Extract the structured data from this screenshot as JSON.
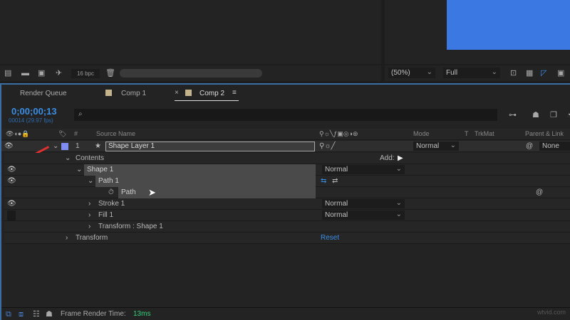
{
  "project_toolbar": {
    "bpc": "16 bpc"
  },
  "viewer_toolbar": {
    "zoom": "(50%)",
    "resolution": "Full"
  },
  "tabs": [
    {
      "label": "Render Queue"
    },
    {
      "label": "Comp 1"
    },
    {
      "label": "Comp 2",
      "close": "×",
      "menu": "≡"
    }
  ],
  "timecode": {
    "current": "0;00;00;13",
    "frames": "00014 (29.97 fps)"
  },
  "search": {
    "placeholder": ""
  },
  "columns": {
    "num": "#",
    "source_name": "Source Name",
    "mode": "Mode",
    "t": "T",
    "trkmat": "TrkMat",
    "parent": "Parent & Link"
  },
  "layer": {
    "number": "1",
    "name": "Shape Layer 1",
    "mode": "Normal",
    "parent": "None",
    "color": "#7f8cf0"
  },
  "tree": {
    "contents": "Contents",
    "add": "Add:",
    "shape1": "Shape 1",
    "shape1_mode": "Normal",
    "path1": "Path 1",
    "path": "Path",
    "stroke1": "Stroke 1",
    "stroke1_mode": "Normal",
    "fill1": "Fill 1",
    "fill1_mode": "Normal",
    "transform_shape": "Transform : Shape 1",
    "transform": "Transform",
    "reset": "Reset"
  },
  "status": {
    "label": "Frame Render Time:",
    "value": "13ms"
  },
  "watermark": "wtvid.com",
  "colors": {
    "accent": "#3a8ee6",
    "viewer_bg": "#3b78e1",
    "render_time": "#33d17a"
  }
}
